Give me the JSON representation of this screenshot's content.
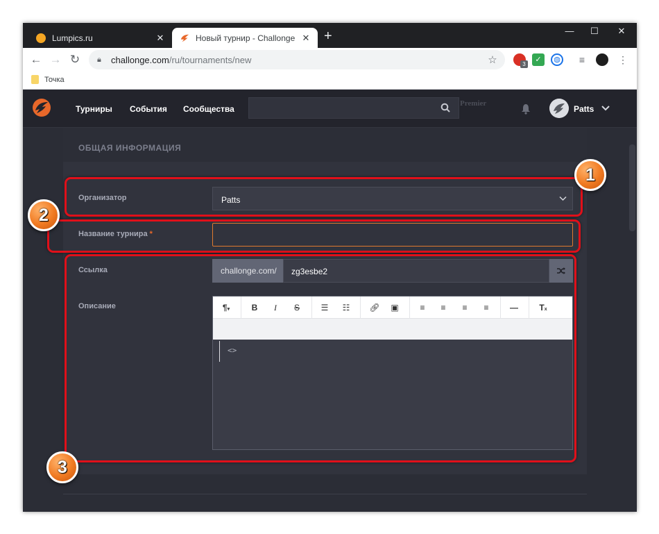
{
  "browser": {
    "tabs": [
      {
        "title": "Lumpics.ru",
        "active": false
      },
      {
        "title": "Новый турнир - Challonge",
        "active": true
      }
    ],
    "new_tab": "+",
    "window_controls": {
      "minimize": "—",
      "maximize": "☐",
      "close": "✕"
    },
    "url_host": "challonge.com",
    "url_path": "/ru/tournaments/new",
    "bookmark": "Точка",
    "extension_badge": "3"
  },
  "site": {
    "nav": [
      "Турниры",
      "События",
      "Сообщества"
    ],
    "search_placeholder": "",
    "ghost_text": "Premier",
    "username": "Patts",
    "accent_color": "#e8682a"
  },
  "form": {
    "section_title": "ОБЩАЯ ИНФОРМАЦИЯ",
    "organizer_label": "Организатор",
    "organizer_value": "Patts",
    "name_label": "Название турнира",
    "required_mark": "*",
    "name_value": "",
    "link_label": "Ссылка",
    "link_prefix": "challonge.com/",
    "link_slug": "zg3esbe2",
    "description_label": "Описание",
    "editor_toolbar": [
      "paragraph-icon",
      "bold-icon",
      "italic-icon",
      "strikethrough-icon",
      "bullet-list-icon",
      "numbered-list-icon",
      "link-icon",
      "image-icon",
      "align-left-icon",
      "align-center-icon",
      "align-right-icon",
      "justify-icon",
      "horizontal-rule-icon",
      "clear-format-icon",
      "code-view-icon"
    ]
  },
  "annotations": {
    "badges": [
      "1",
      "2",
      "3"
    ],
    "highlight_color": "#e0101a",
    "badge_color": "#f07a22"
  }
}
